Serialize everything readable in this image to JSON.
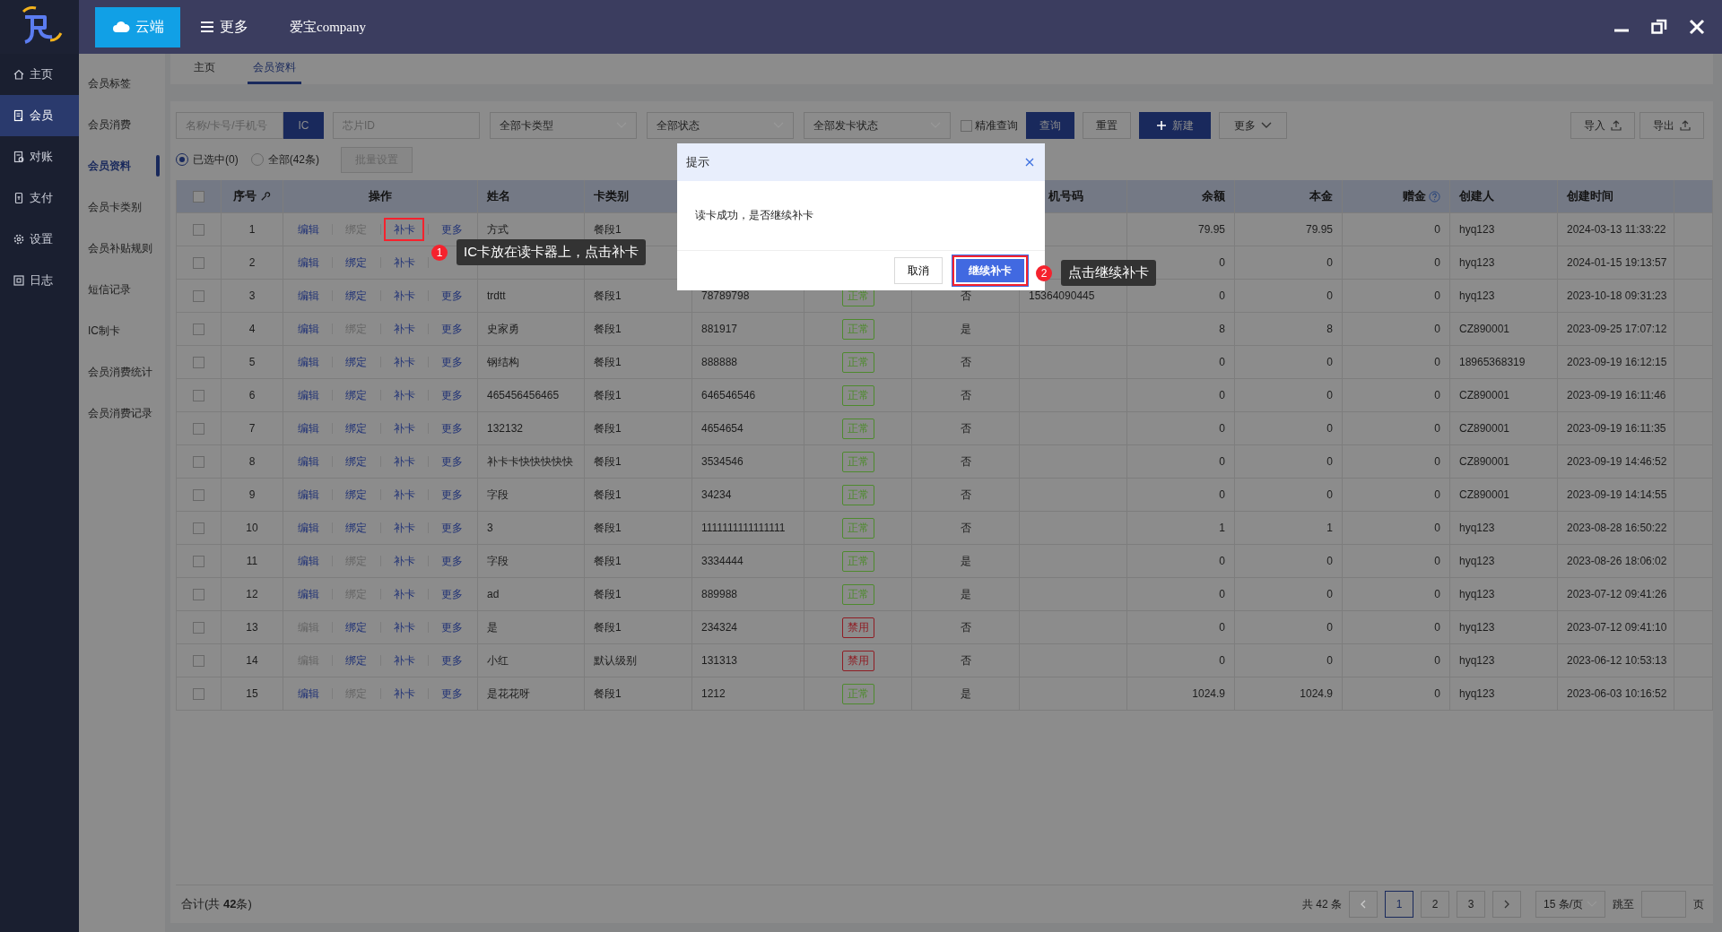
{
  "top_bar": {
    "cloud_button": "云端",
    "more_menu": "更多",
    "company": "爱宝company"
  },
  "sidebar": {
    "items": [
      {
        "label": "主页",
        "kind": "home",
        "selected": false
      },
      {
        "label": "会员",
        "kind": "member",
        "selected": true
      },
      {
        "label": "对账",
        "kind": "reconcile",
        "selected": false
      },
      {
        "label": "支付",
        "kind": "pay",
        "selected": false
      },
      {
        "label": "设置",
        "kind": "settings",
        "selected": false
      },
      {
        "label": "日志",
        "kind": "log",
        "selected": false
      }
    ]
  },
  "subnav": {
    "items": [
      {
        "label": "会员标签",
        "selected": false
      },
      {
        "label": "会员消费",
        "selected": false
      },
      {
        "label": "会员资料",
        "selected": true
      },
      {
        "label": "会员卡类别",
        "selected": false
      },
      {
        "label": "会员补贴规则",
        "selected": false
      },
      {
        "label": "短信记录",
        "selected": false
      },
      {
        "label": "IC制卡",
        "selected": false
      },
      {
        "label": "会员消费统计",
        "selected": false
      },
      {
        "label": "会员消费记录",
        "selected": false
      }
    ]
  },
  "tabs": [
    {
      "label": "主页",
      "selected": false
    },
    {
      "label": "会员资料",
      "selected": true
    }
  ],
  "filters": {
    "search": {
      "placeholder": "名称/卡号/手机号"
    },
    "ic_button": "IC",
    "chip": {
      "placeholder": "芯片ID"
    },
    "dropdowns": [
      "全部卡类型",
      "全部状态",
      "全部发卡状态"
    ],
    "exact": {
      "label": "精准查询",
      "checked": false
    },
    "buttons": [
      {
        "label": "查询",
        "kind": "primary"
      },
      {
        "label": "重置",
        "kind": "default"
      },
      {
        "label": "新建",
        "kind": "create"
      },
      {
        "label": "更多",
        "kind": "dropdown"
      }
    ],
    "import": "导入",
    "export": "导出"
  },
  "selection": {
    "options": [
      {
        "label": "已选中(0)",
        "selected": true
      },
      {
        "label": "全部(42条)",
        "selected": false
      }
    ],
    "batch_button": {
      "label": "批量设置",
      "disabled": true
    }
  },
  "table": {
    "select_all_checked": false,
    "headers": {
      "index": "序号",
      "actions": "操作",
      "name": "姓名",
      "card_type": "卡类别",
      "phone": "机号码",
      "balance": "余额",
      "principal": "本金",
      "bonus": "赠金",
      "creator": "创建人",
      "created": "创建时间"
    },
    "rows": [
      {
        "index": "1",
        "checked": false,
        "actions": [
          {
            "label": "编辑",
            "disabled": false
          },
          {
            "label": "绑定",
            "disabled": true
          },
          {
            "label": "补卡",
            "disabled": false,
            "highlighted": true
          },
          {
            "label": "更多",
            "disabled": false
          }
        ],
        "name": "方式",
        "card_type": "餐段1",
        "balance": "79.95",
        "principal": "79.95",
        "bonus": "0",
        "creator": "hyq123",
        "created": "2024-03-13 11:33:22"
      },
      {
        "index": "2",
        "checked": false,
        "actions": [
          {
            "label": "编辑",
            "disabled": false
          },
          {
            "label": "绑定",
            "disabled": false
          },
          {
            "label": "补卡",
            "disabled": false
          }
        ],
        "balance": "0",
        "principal": "0",
        "bonus": "0",
        "creator": "hyq123",
        "created": "2024-01-15 19:13:57"
      },
      {
        "index": "3",
        "checked": false,
        "actions": [
          {
            "label": "编辑",
            "disabled": false
          },
          {
            "label": "绑定",
            "disabled": false
          },
          {
            "label": "补卡",
            "disabled": false
          },
          {
            "label": "更多",
            "disabled": false
          }
        ],
        "name": "trdtt",
        "card_type": "餐段1",
        "column_6": "78789798",
        "column_7": {
          "text": "正常",
          "color": "#4e8a2e"
        },
        "column_8": "否",
        "phone": "15364090445",
        "balance": "0",
        "principal": "0",
        "bonus": "0",
        "creator": "hyq123",
        "created": "2023-10-18 09:31:23"
      },
      {
        "index": "4",
        "checked": false,
        "actions": [
          {
            "label": "编辑",
            "disabled": false
          },
          {
            "label": "绑定",
            "disabled": true
          },
          {
            "label": "补卡",
            "disabled": false
          },
          {
            "label": "更多",
            "disabled": false
          }
        ],
        "name": "史家勇",
        "card_type": "餐段1",
        "column_6": "881917",
        "column_7": {
          "text": "正常",
          "color": "#4e8a2e"
        },
        "column_8": "是",
        "balance": "8",
        "principal": "8",
        "bonus": "0",
        "creator": "CZ890001",
        "created": "2023-09-25 17:07:12"
      },
      {
        "index": "5",
        "checked": false,
        "actions": [
          {
            "label": "编辑",
            "disabled": false
          },
          {
            "label": "绑定",
            "disabled": false
          },
          {
            "label": "补卡",
            "disabled": false
          },
          {
            "label": "更多",
            "disabled": false
          }
        ],
        "name": "钢结构",
        "card_type": "餐段1",
        "column_6": "888888",
        "column_7": {
          "text": "正常",
          "color": "#4e8a2e"
        },
        "column_8": "否",
        "balance": "0",
        "principal": "0",
        "bonus": "0",
        "creator": "18965368319",
        "created": "2023-09-19 16:12:15"
      },
      {
        "index": "6",
        "checked": false,
        "actions": [
          {
            "label": "编辑",
            "disabled": false
          },
          {
            "label": "绑定",
            "disabled": false
          },
          {
            "label": "补卡",
            "disabled": false
          },
          {
            "label": "更多",
            "disabled": false
          }
        ],
        "name": "465456456465",
        "card_type": "餐段1",
        "column_6": "646546546",
        "column_7": {
          "text": "正常",
          "color": "#4e8a2e"
        },
        "column_8": "否",
        "balance": "0",
        "principal": "0",
        "bonus": "0",
        "creator": "CZ890001",
        "created": "2023-09-19 16:11:46"
      },
      {
        "index": "7",
        "checked": false,
        "actions": [
          {
            "label": "编辑",
            "disabled": false
          },
          {
            "label": "绑定",
            "disabled": false
          },
          {
            "label": "补卡",
            "disabled": false
          },
          {
            "label": "更多",
            "disabled": false
          }
        ],
        "name": "132132",
        "card_type": "餐段1",
        "column_6": "4654654",
        "column_7": {
          "text": "正常",
          "color": "#4e8a2e"
        },
        "column_8": "否",
        "balance": "0",
        "principal": "0",
        "bonus": "0",
        "creator": "CZ890001",
        "created": "2023-09-19 16:11:35"
      },
      {
        "index": "8",
        "checked": false,
        "actions": [
          {
            "label": "编辑",
            "disabled": false
          },
          {
            "label": "绑定",
            "disabled": false
          },
          {
            "label": "补卡",
            "disabled": false
          },
          {
            "label": "更多",
            "disabled": false
          }
        ],
        "name": "补卡卡快快快快快",
        "card_type": "餐段1",
        "column_6": "3534546",
        "column_7": {
          "text": "正常",
          "color": "#4e8a2e"
        },
        "column_8": "否",
        "balance": "0",
        "principal": "0",
        "bonus": "0",
        "creator": "CZ890001",
        "created": "2023-09-19 14:46:52"
      },
      {
        "index": "9",
        "checked": false,
        "actions": [
          {
            "label": "编辑",
            "disabled": false
          },
          {
            "label": "绑定",
            "disabled": false
          },
          {
            "label": "补卡",
            "disabled": false
          },
          {
            "label": "更多",
            "disabled": false
          }
        ],
        "name": "字段",
        "card_type": "餐段1",
        "column_6": "34234",
        "column_7": {
          "text": "正常",
          "color": "#4e8a2e"
        },
        "column_8": "否",
        "balance": "0",
        "principal": "0",
        "bonus": "0",
        "creator": "CZ890001",
        "created": "2023-09-19 14:14:55"
      },
      {
        "index": "10",
        "checked": false,
        "actions": [
          {
            "label": "编辑",
            "disabled": false
          },
          {
            "label": "绑定",
            "disabled": false
          },
          {
            "label": "补卡",
            "disabled": false
          },
          {
            "label": "更多",
            "disabled": false
          }
        ],
        "name": "3",
        "card_type": "餐段1",
        "column_6": "1111111111111111",
        "column_7": {
          "text": "正常",
          "color": "#4e8a2e"
        },
        "column_8": "否",
        "balance": "1",
        "principal": "1",
        "bonus": "0",
        "creator": "hyq123",
        "created": "2023-08-28 16:50:22"
      },
      {
        "index": "11",
        "checked": false,
        "actions": [
          {
            "label": "编辑",
            "disabled": false
          },
          {
            "label": "绑定",
            "disabled": true
          },
          {
            "label": "补卡",
            "disabled": false
          },
          {
            "label": "更多",
            "disabled": false
          }
        ],
        "name": "字段",
        "card_type": "餐段1",
        "column_6": "3334444",
        "column_7": {
          "text": "正常",
          "color": "#4e8a2e"
        },
        "column_8": "是",
        "balance": "0",
        "principal": "0",
        "bonus": "0",
        "creator": "hyq123",
        "created": "2023-08-26 18:06:02"
      },
      {
        "index": "12",
        "checked": false,
        "actions": [
          {
            "label": "编辑",
            "disabled": false
          },
          {
            "label": "绑定",
            "disabled": true
          },
          {
            "label": "补卡",
            "disabled": false
          },
          {
            "label": "更多",
            "disabled": false
          }
        ],
        "name": "ad",
        "card_type": "餐段1",
        "column_6": "889988",
        "column_7": {
          "text": "正常",
          "color": "#4e8a2e"
        },
        "column_8": "是",
        "balance": "0",
        "principal": "0",
        "bonus": "0",
        "creator": "hyq123",
        "created": "2023-07-12 09:41:26"
      },
      {
        "index": "13",
        "checked": false,
        "actions": [
          {
            "label": "编辑",
            "disabled": true
          },
          {
            "label": "绑定",
            "disabled": false
          },
          {
            "label": "补卡",
            "disabled": false
          },
          {
            "label": "更多",
            "disabled": false
          }
        ],
        "name": "是",
        "card_type": "餐段1",
        "column_6": "234324",
        "column_7": {
          "text": "禁用",
          "color": "#8f1d24"
        },
        "column_8": "否",
        "balance": "0",
        "principal": "0",
        "bonus": "0",
        "creator": "hyq123",
        "created": "2023-07-12 09:41:10"
      },
      {
        "index": "14",
        "checked": false,
        "actions": [
          {
            "label": "编辑",
            "disabled": true
          },
          {
            "label": "绑定",
            "disabled": false
          },
          {
            "label": "补卡",
            "disabled": false
          },
          {
            "label": "更多",
            "disabled": false
          }
        ],
        "name": "小红",
        "card_type": "默认级别",
        "column_6": "131313",
        "column_7": {
          "text": "禁用",
          "color": "#8f1d24"
        },
        "column_8": "否",
        "balance": "0",
        "principal": "0",
        "bonus": "0",
        "creator": "hyq123",
        "created": "2023-06-12 10:53:13"
      },
      {
        "index": "15",
        "checked": false,
        "actions": [
          {
            "label": "编辑",
            "disabled": false
          },
          {
            "label": "绑定",
            "disabled": true
          },
          {
            "label": "补卡",
            "disabled": false
          },
          {
            "label": "更多",
            "disabled": false
          }
        ],
        "name": "是花花呀",
        "card_type": "餐段1",
        "column_6": "1212",
        "column_7": {
          "text": "正常",
          "color": "#4e8a2e"
        },
        "column_8": "是",
        "balance": "1024.9",
        "principal": "1024.9",
        "bonus": "0",
        "creator": "hyq123",
        "created": "2023-06-03 10:16:52"
      }
    ]
  },
  "footer": {
    "total": "合计(共 **42**条)",
    "pagination": {
      "total": "共 42 条",
      "prev_disabled": true,
      "next_disabled": false,
      "pages": [
        {
          "label": "1",
          "selected": true
        },
        {
          "label": "2",
          "selected": false
        },
        {
          "label": "3",
          "selected": false
        }
      ],
      "page_size": "15 条/页",
      "jump_label": "跳至",
      "page_unit": "页"
    }
  },
  "modal": {
    "title": "提示",
    "message": "读卡成功，是否继续补卡",
    "buttons": [
      {
        "label": "取消",
        "kind": "default",
        "highlighted": false
      },
      {
        "label": "继续补卡",
        "kind": "primary",
        "highlighted": true
      }
    ]
  },
  "callouts": [
    {
      "number": "1",
      "text": "IC卡放在读卡器上，点击补卡"
    },
    {
      "number": "2",
      "text": "点击继续补卡"
    }
  ]
}
